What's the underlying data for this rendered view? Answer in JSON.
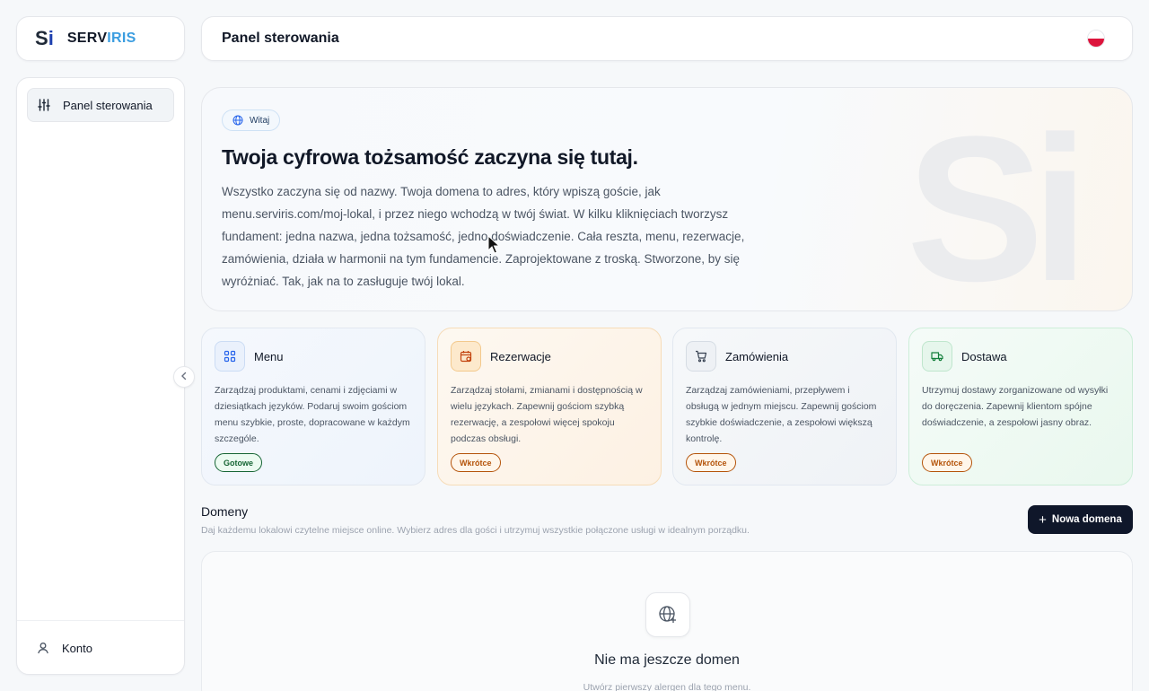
{
  "logo": {
    "mark_s": "S",
    "mark_i": "i",
    "text_a": "SERV",
    "text_b": "IRIS"
  },
  "header": {
    "title": "Panel sterowania",
    "language_icon": "poland-flag-icon"
  },
  "sidebar": {
    "items": [
      {
        "label": "Panel sterowania",
        "icon": "sliders-icon",
        "active": true
      }
    ],
    "bottom": {
      "label": "Konto",
      "icon": "user-icon"
    }
  },
  "hero": {
    "badge": "Witaj",
    "title": "Twoja cyfrowa tożsamość zaczyna się tutaj.",
    "text": "Wszystko zaczyna się od nazwy. Twoja domena to adres, który wpiszą goście, jak menu.serviris.com/moj-lokal, i przez niego wchodzą w twój świat. W kilku kliknięciach tworzysz fundament: jedna nazwa, jedna tożsamość, jedno doświadczenie. Cała reszta, menu, rezerwacje, zamówienia, działa w harmonii na tym fundamencie. Zaprojektowane z troską. Stworzone, by się wyróżniać. Tak, jak na to zasługuje twój lokal.",
    "watermark": "Si"
  },
  "features": [
    {
      "name": "Menu",
      "icon": "grid-icon",
      "desc": "Zarządzaj produktami, cenami i zdjęciami w dziesiątkach języków. Podaruj swoim gościom menu szybkie, proste, dopracowane w każdym szczególe.",
      "status": "Gotowe"
    },
    {
      "name": "Rezerwacje",
      "icon": "calendar-icon",
      "desc": "Zarządzaj stołami, zmianami i dostępnością w wielu językach. Zapewnij gościom szybką rezerwację, a zespołowi więcej spokoju podczas obsługi.",
      "status": "Wkrótce"
    },
    {
      "name": "Zamówienia",
      "icon": "cart-icon",
      "desc": "Zarządzaj zamówieniami, przepływem i obsługą w jednym miejscu. Zapewnij gościom szybkie doświadczenie, a zespołowi większą kontrolę.",
      "status": "Wkrótce"
    },
    {
      "name": "Dostawa",
      "icon": "truck-icon",
      "desc": "Utrzymuj dostawy zorganizowane od wysyłki do doręczenia. Zapewnij klientom spójne doświadczenie, a zespołowi jasny obraz.",
      "status": "Wkrótce"
    }
  ],
  "domains": {
    "title": "Domeny",
    "subtitle": "Daj każdemu lokalowi czytelne miejsce online. Wybierz adres dla gości i utrzymuj wszystkie połączone usługi w idealnym porządku.",
    "new_button": "Nowa domena",
    "empty_title": "Nie ma jeszcze domen",
    "empty_subtitle": "Utwórz pierwszy alergen dla tego menu."
  }
}
